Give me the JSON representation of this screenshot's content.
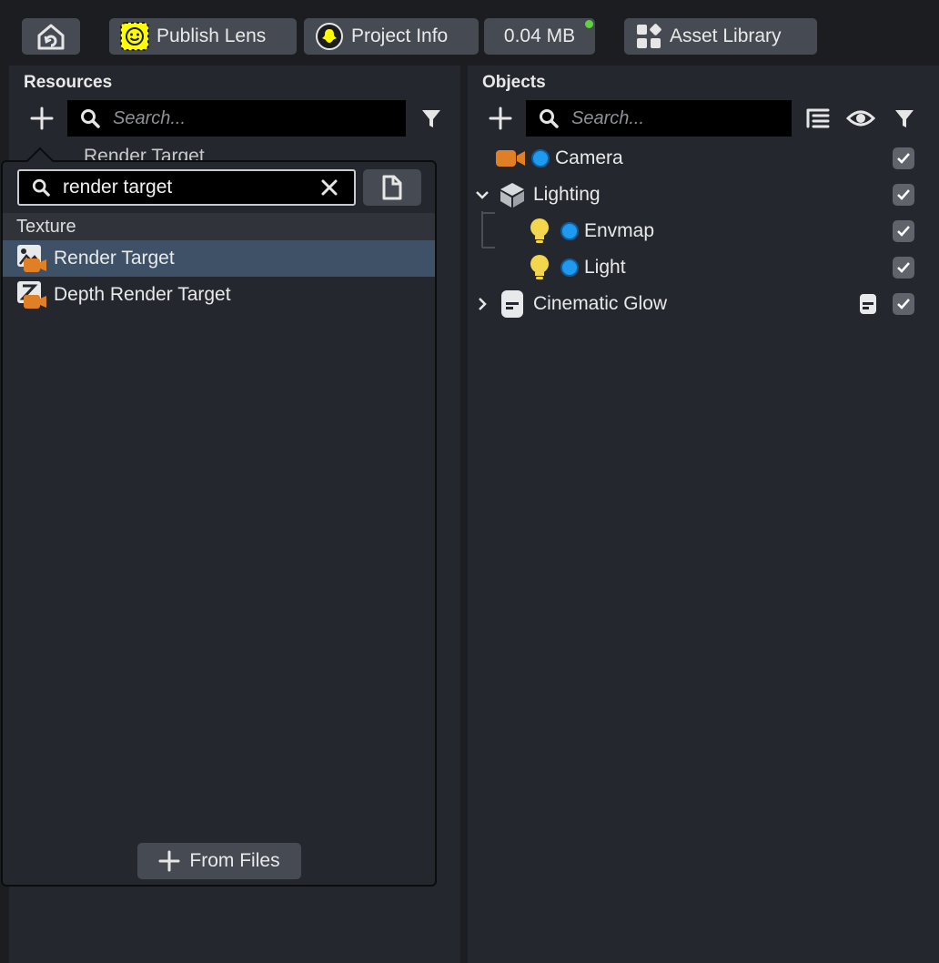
{
  "toolbar": {
    "home_label": "",
    "publish_label": "Publish Lens",
    "project_label": "Project Info",
    "size_label": "0.04 MB",
    "library_label": "Asset Library"
  },
  "resources": {
    "title": "Resources",
    "search_placeholder": "Search...",
    "behind_item_label": "Render Target"
  },
  "popup": {
    "search_value": "render target",
    "section": "Texture",
    "items": [
      {
        "label": "Render Target",
        "selected": true
      },
      {
        "label": "Depth Render Target",
        "selected": false
      }
    ],
    "from_files_label": "From Files"
  },
  "objects": {
    "title": "Objects",
    "search_placeholder": "Search...",
    "items": [
      {
        "label": "Camera",
        "checked": true
      },
      {
        "label": "Lighting",
        "checked": true,
        "expanded": true
      },
      {
        "label": "Envmap",
        "checked": true
      },
      {
        "label": "Light",
        "checked": true
      },
      {
        "label": "Cinematic Glow",
        "checked": true,
        "expanded": false
      }
    ]
  },
  "colors": {
    "accent_blue": "#1e9bf0",
    "selection": "#3e5166",
    "camera_orange": "#e07f26",
    "light_yellow": "#f3d54e",
    "online_green": "#5fd33d"
  }
}
